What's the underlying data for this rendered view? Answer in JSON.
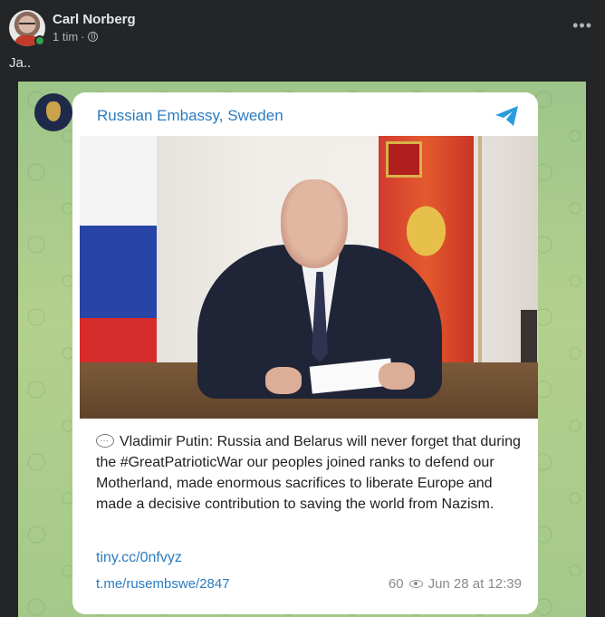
{
  "post": {
    "author": "Carl Norberg",
    "time": "1 tim",
    "separator": "·",
    "text": "Ja..",
    "more_label": "•••",
    "privacy_icon": "globe-icon"
  },
  "telegram": {
    "channel_name": "Russian Embassy, Sweden",
    "message": "Vladimir Putin: Russia and Belarus will never forget that during the #GreatPatrioticWar our peoples joined ranks to defend our Motherland, made enormous sacrifices to liberate Europe and made a decisive contribution to saving the world from Nazism.",
    "short_link": "tiny.cc/0nfvyz",
    "tme_link": "t.me/rusembswe/2847",
    "views": "60",
    "date": "Jun 28 at 12:39"
  },
  "colors": {
    "background": "#242526",
    "link": "#2b7bbf",
    "online": "#31a24c",
    "chat_bg": "#a4c98a"
  }
}
